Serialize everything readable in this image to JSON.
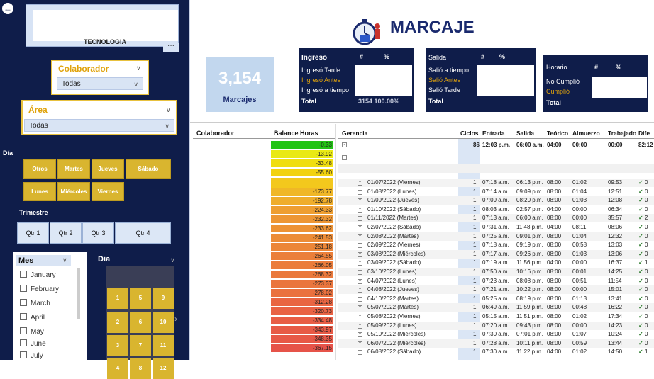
{
  "app": {
    "title": "MARCAJE"
  },
  "sidebar": {
    "department_label": "TECNOLOGIA",
    "colaborador": {
      "title": "Colaborador",
      "value": "Todas"
    },
    "area": {
      "title": "Área",
      "value": "Todas"
    },
    "dia_section": "Día",
    "dia_buttons": [
      "Otros",
      "Martes",
      "Jueves",
      "Sábado",
      "Lunes",
      "Miércoles",
      "Viernes"
    ],
    "trimestre_section": "Trimestre",
    "trimestre_buttons": [
      "Qtr 1",
      "Qtr 2",
      "Qtr 3",
      "Qtr 4"
    ],
    "mes": {
      "title": "Mes",
      "items": [
        "January",
        "February",
        "March",
        "April",
        "May",
        "June",
        "July"
      ]
    },
    "dia_grid": {
      "title": "Dia",
      "values": [
        "1",
        "5",
        "9",
        "2",
        "6",
        "10",
        "3",
        "7",
        "11",
        "4",
        "8",
        "12"
      ]
    }
  },
  "kpi": {
    "value": "3,154",
    "label": "Marcajes"
  },
  "ingreso_table": {
    "title": "Ingreso",
    "col_num": "#",
    "col_pct": "%",
    "rows": [
      "Ingresó Tarde",
      "Ingresó Antes",
      "Ingresó a tiempo"
    ],
    "total_label": "Total",
    "total_partial": "3154  100.00%"
  },
  "salida_table": {
    "title": "Salida",
    "col_num": "#",
    "col_pct": "%",
    "rows": [
      "Salió a tiempo",
      "Salió Antes",
      "Salió Tarde"
    ],
    "total_label": "Total"
  },
  "horario_table": {
    "title": "Horario",
    "col_num": "#",
    "col_pct": "%",
    "rows": [
      "No Cumplió",
      "Cumplió"
    ],
    "total_label": "Total"
  },
  "balance": {
    "header_collab": "Colaborador",
    "header_balance": "Balance Horas",
    "values": [
      "-0.33",
      "-13.92",
      "-33.48",
      "-55.60",
      "-173.77",
      "-192.78",
      "-224.33",
      "-232.32",
      "-233.62",
      "-241.53",
      "-251.18",
      "-264.55",
      "-266.05",
      "-268.32",
      "-273.37",
      "-278.02",
      "-312.28",
      "-320.73",
      "-334.48",
      "-343.97",
      "-348.35",
      "-367.15"
    ],
    "colors": [
      "#22c414",
      "#e9e914",
      "#f0de10",
      "#f2d20f",
      "#f0b726",
      "#efad2b",
      "#ee9e31",
      "#ed9634",
      "#ed9234",
      "#ec8c37",
      "#ec8638",
      "#eb7f3a",
      "#eb7c3b",
      "#ea793c",
      "#ea753d",
      "#ea713e",
      "#e96542",
      "#e96244",
      "#e85d45",
      "#e75a46",
      "#e75847",
      "#e65349"
    ]
  },
  "detail": {
    "headers": [
      "Gerencia",
      "Ciclos",
      "Entrada",
      "Salida",
      "Teórico",
      "Almuerzo",
      "Trabajado",
      "Dife"
    ],
    "total_row": {
      "ciclos": "86",
      "entrada": "12:03 p.m.",
      "salida": "06:00 a.m.",
      "teorico": "04:00",
      "almuerzo": "00:00",
      "trabajado": "00:00",
      "dife": "82:12"
    },
    "rows": [
      [
        "01/07/2022 (Viernes)",
        "1",
        "07:18 a.m.",
        "06:13 p.m.",
        "08:00",
        "01:02",
        "09:53",
        "0"
      ],
      [
        "01/08/2022 (Lunes)",
        "1",
        "07:14 a.m.",
        "09:09 p.m.",
        "08:00",
        "01:04",
        "12:51",
        "0"
      ],
      [
        "01/09/2022 (Jueves)",
        "1",
        "07:09 a.m.",
        "08:20 p.m.",
        "08:00",
        "01:03",
        "12:08",
        "0"
      ],
      [
        "01/10/2022 (Sábado)",
        "1",
        "08:03 a.m.",
        "02:57 p.m.",
        "04:00",
        "00:00",
        "06:34",
        "0"
      ],
      [
        "01/11/2022 (Martes)",
        "1",
        "07:13 a.m.",
        "06:00 a.m.",
        "08:00",
        "00:00",
        "35:57",
        "2"
      ],
      [
        "02/07/2022 (Sábado)",
        "1",
        "07:31 a.m.",
        "11:48 p.m.",
        "04:00",
        "08:11",
        "08:06",
        "0"
      ],
      [
        "02/08/2022 (Martes)",
        "1",
        "07:25 a.m.",
        "09:01 p.m.",
        "08:00",
        "01:04",
        "12:32",
        "0"
      ],
      [
        "02/09/2022 (Viernes)",
        "1",
        "07:18 a.m.",
        "09:19 p.m.",
        "08:00",
        "00:58",
        "13:03",
        "0"
      ],
      [
        "03/08/2022 (Miércoles)",
        "1",
        "07:17 a.m.",
        "09:26 p.m.",
        "08:00",
        "01:03",
        "13:06",
        "0"
      ],
      [
        "03/09/2022 (Sábado)",
        "1",
        "07:19 a.m.",
        "11:56 p.m.",
        "04:00",
        "00:00",
        "16:37",
        "1"
      ],
      [
        "03/10/2022 (Lunes)",
        "1",
        "07:50 a.m.",
        "10:16 p.m.",
        "08:00",
        "00:01",
        "14:25",
        "0"
      ],
      [
        "04/07/2022 (Lunes)",
        "1",
        "07:23 a.m.",
        "08:08 p.m.",
        "08:00",
        "00:51",
        "11:54",
        "0"
      ],
      [
        "04/08/2022 (Jueves)",
        "1",
        "07:21 a.m.",
        "10:22 p.m.",
        "08:00",
        "00:00",
        "15:01",
        "0"
      ],
      [
        "04/10/2022 (Martes)",
        "1",
        "05:25 a.m.",
        "08:19 p.m.",
        "08:00",
        "01:13",
        "13:41",
        "0"
      ],
      [
        "05/07/2022 (Martes)",
        "1",
        "06:49 a.m.",
        "11:59 p.m.",
        "08:00",
        "00:48",
        "16:22",
        "0"
      ],
      [
        "05/08/2022 (Viernes)",
        "1",
        "05:15 a.m.",
        "11:51 p.m.",
        "08:00",
        "01:02",
        "17:34",
        "0"
      ],
      [
        "05/09/2022 (Lunes)",
        "1",
        "07:20 a.m.",
        "09:43 p.m.",
        "08:00",
        "00:00",
        "14:23",
        "0"
      ],
      [
        "05/10/2022 (Miércoles)",
        "1",
        "07:30 a.m.",
        "07:01 p.m.",
        "08:00",
        "01:07",
        "10:24",
        "0"
      ],
      [
        "06/07/2022 (Miércoles)",
        "1",
        "07:28 a.m.",
        "10:11 p.m.",
        "08:00",
        "00:59",
        "13:44",
        "0"
      ],
      [
        "06/08/2022 (Sábado)",
        "1",
        "07:30 a.m.",
        "11:22 p.m.",
        "04:00",
        "01:02",
        "14:50",
        "1"
      ]
    ]
  }
}
